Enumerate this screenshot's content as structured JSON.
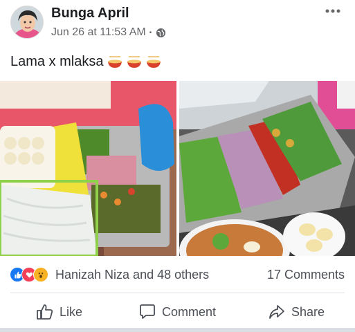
{
  "post": {
    "author": "Bunga April",
    "timestamp": "Jun 26 at 11:53 AM",
    "separator": "•",
    "privacy_icon": "globe-icon",
    "text": "Lama x mlaksa",
    "text_emoji": [
      "bowl-icon",
      "bowl-icon",
      "bowl-icon"
    ]
  },
  "photos": [
    {
      "subject": "noodles-and-vegetables-trays"
    },
    {
      "subject": "salad-vegetables-and-laksa-bowl"
    }
  ],
  "reactions": {
    "icons": [
      "like-icon",
      "love-icon",
      "wow-icon"
    ],
    "likers_text": "Hanizah Niza and 48 others",
    "comments_text": "17 Comments"
  },
  "actions": {
    "like_label": "Like",
    "comment_label": "Comment",
    "share_label": "Share"
  },
  "colors": {
    "like_blue": "#1877f2",
    "love_red": "#f33e58",
    "wow_yellow": "#f7b125",
    "text_secondary": "#65676b"
  }
}
